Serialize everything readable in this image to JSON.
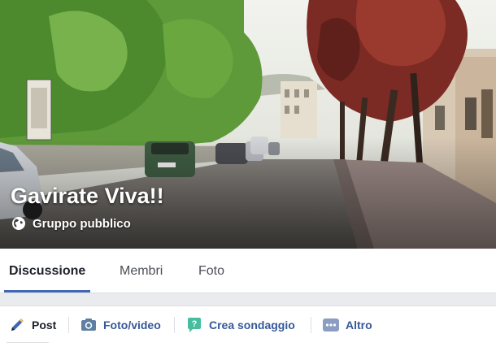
{
  "group": {
    "name": "Gavirate Viva!!",
    "privacy_label": "Gruppo pubblico"
  },
  "tabs": [
    {
      "label": "Discussione",
      "active": true
    },
    {
      "label": "Membri",
      "active": false
    },
    {
      "label": "Foto",
      "active": false
    }
  ],
  "composer": {
    "post_label": "Post",
    "photo_video_label": "Foto/video",
    "poll_label": "Crea sondaggio",
    "more_label": "Altro"
  },
  "colors": {
    "accent": "#4267b2",
    "link": "#365899",
    "poll_icon": "#45bd9e",
    "photo_icon": "#5f7ea3",
    "more_icon": "#8b9dc3"
  },
  "icons": {
    "globe": "globe-icon",
    "post": "pencil-icon",
    "photo": "camera-icon",
    "poll": "poll-bubble-icon",
    "more": "more-dots-icon"
  }
}
